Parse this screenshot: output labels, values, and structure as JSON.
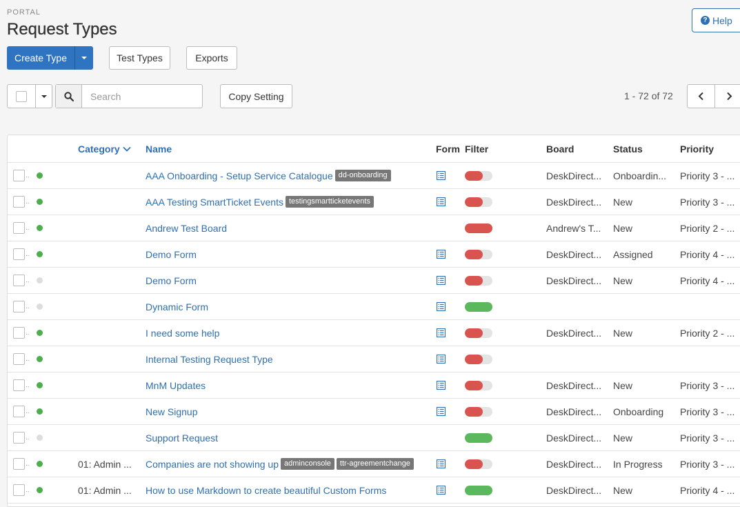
{
  "header": {
    "breadcrumb": "PORTAL",
    "title": "Request Types",
    "help_label": "Help"
  },
  "toolbar": {
    "create_label": "Create Type",
    "test_types_label": "Test Types",
    "exports_label": "Exports",
    "copy_setting_label": "Copy Setting",
    "search_placeholder": "Search",
    "pager_text": "1 - 72 of 72"
  },
  "colors": {
    "primary": "#2f74c0",
    "link": "#2f6fb3",
    "status_on": "#4cae4c",
    "toggle_red": "#d9534f",
    "toggle_green": "#5cb85c",
    "tag_bg": "#777777"
  },
  "table": {
    "columns": {
      "category": "Category",
      "name": "Name",
      "form": "Form",
      "filter": "Filter",
      "board": "Board",
      "status": "Status",
      "priority": "Priority"
    },
    "rows": [
      {
        "active": true,
        "category": "",
        "name": "AAA Onboarding - Setup Service Catalogue",
        "tags": [
          "dd-onboarding"
        ],
        "form": true,
        "filter": "off",
        "board": "DeskDirect...",
        "status": "Onboardin...",
        "priority": "Priority 3 - ..."
      },
      {
        "active": true,
        "category": "",
        "name": "AAA Testing SmartTicket Events",
        "tags": [
          "testingsmartticketevents"
        ],
        "form": true,
        "filter": "off",
        "board": "DeskDirect...",
        "status": "New",
        "priority": "Priority 3 - ..."
      },
      {
        "active": true,
        "category": "",
        "name": "Andrew Test Board",
        "tags": [],
        "form": false,
        "filter": "red-full",
        "board": "Andrew's T...",
        "status": "New",
        "priority": "Priority 2 - ..."
      },
      {
        "active": true,
        "category": "",
        "name": "Demo Form",
        "tags": [],
        "form": true,
        "filter": "off",
        "board": "DeskDirect...",
        "status": "Assigned",
        "priority": "Priority 4 - ..."
      },
      {
        "active": false,
        "category": "",
        "name": "Demo Form",
        "tags": [],
        "form": true,
        "filter": "off",
        "board": "DeskDirect...",
        "status": "New",
        "priority": "Priority 4 - ..."
      },
      {
        "active": false,
        "category": "",
        "name": "Dynamic Form",
        "tags": [],
        "form": true,
        "filter": "green-full",
        "board": "",
        "status": "",
        "priority": ""
      },
      {
        "active": true,
        "category": "",
        "name": "I need some help",
        "tags": [],
        "form": true,
        "filter": "off",
        "board": "DeskDirect...",
        "status": "New",
        "priority": "Priority 2 - ..."
      },
      {
        "active": true,
        "category": "",
        "name": "Internal Testing Request Type",
        "tags": [],
        "form": true,
        "filter": "off",
        "board": "",
        "status": "",
        "priority": ""
      },
      {
        "active": true,
        "category": "",
        "name": "MnM Updates",
        "tags": [],
        "form": true,
        "filter": "off",
        "board": "DeskDirect...",
        "status": "New",
        "priority": "Priority 3 - ..."
      },
      {
        "active": true,
        "category": "",
        "name": "New Signup",
        "tags": [],
        "form": true,
        "filter": "off",
        "board": "DeskDirect...",
        "status": "Onboarding",
        "priority": "Priority 3 - ..."
      },
      {
        "active": false,
        "category": "",
        "name": "Support Request",
        "tags": [],
        "form": false,
        "filter": "green-full",
        "board": "DeskDirect...",
        "status": "New",
        "priority": "Priority 3 - ..."
      },
      {
        "active": true,
        "category": "01: Admin ...",
        "name": "Companies are not showing up",
        "tags": [
          "adminconsole",
          "ttr-agreementchange"
        ],
        "form": true,
        "filter": "off",
        "board": "DeskDirect...",
        "status": "In Progress",
        "priority": "Priority 3 - ..."
      },
      {
        "active": true,
        "category": "01: Admin ...",
        "name": "How to use Markdown to create beautiful Custom Forms",
        "tags": [],
        "form": true,
        "filter": "green-full",
        "board": "DeskDirect...",
        "status": "New",
        "priority": "Priority 4 - ..."
      }
    ]
  }
}
